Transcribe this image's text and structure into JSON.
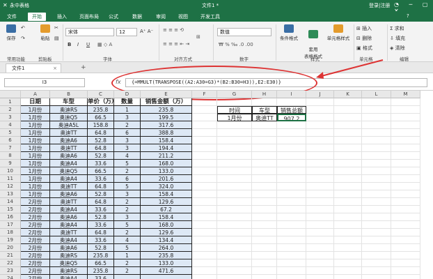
{
  "titlebar": {
    "logo": "✕",
    "app": "永中表格",
    "document": "文件1 *",
    "login": "登录|注册",
    "window_buttons": "◔ ─ ▢ ✕"
  },
  "menu": {
    "items": [
      "文件",
      "开始",
      "插入",
      "页面布局",
      "公式",
      "数据",
      "审阅",
      "视图",
      "开发工具"
    ],
    "active": "开始",
    "help": "?"
  },
  "ribbon": {
    "save": "保存",
    "paste": "粘贴",
    "common": "常用功能",
    "clipboard": "剪贴板",
    "font_name": "宋体",
    "font_size": "12",
    "font_group": "字体",
    "align_group": "对齐方式",
    "number_format": "数值",
    "number_group": "数字",
    "cond_format": "条件格式",
    "table_format": "套用\n表格格式",
    "cell_style": "单元格样式",
    "style_group": "样式",
    "insert": "插入",
    "delete": "删除",
    "format": "格式",
    "cells_group": "单元格",
    "sum": "求和",
    "fill": "填充",
    "clear": "清除",
    "edit_group": "编辑",
    "bold": "B",
    "italic": "I",
    "underline": "U"
  },
  "tabs": {
    "file_tab": "文件1",
    "close": "×",
    "new_tab": "+"
  },
  "formula_bar": {
    "name_box": "I3",
    "fx": "fx",
    "formula": "{=MMULT(TRANSPOSE((A2:A30=G3)*(B2:B30=H3)),E2:E30)}"
  },
  "columns": [
    "A",
    "B",
    "C",
    "D",
    "E",
    "F",
    "G",
    "H",
    "I",
    "J",
    "K",
    "L",
    "M"
  ],
  "table": {
    "headers": [
      "日期",
      "车型",
      "单价（万）",
      "数量",
      "销售金额（万）"
    ],
    "rows": [
      [
        "1月份",
        "奥迪RS",
        "235.8",
        "1",
        "235.8"
      ],
      [
        "1月份",
        "奥迪Q5",
        "66.5",
        "3",
        "199.5"
      ],
      [
        "1月份",
        "奥迪A5L",
        "158.8",
        "2",
        "317.6"
      ],
      [
        "1月份",
        "奥迪TT",
        "64.8",
        "6",
        "388.8"
      ],
      [
        "1月份",
        "奥迪A6",
        "52.8",
        "3",
        "158.4"
      ],
      [
        "1月份",
        "奥迪TT",
        "64.8",
        "3",
        "194.4"
      ],
      [
        "1月份",
        "奥迪A6",
        "52.8",
        "4",
        "211.2"
      ],
      [
        "1月份",
        "奥迪A4",
        "33.6",
        "5",
        "168.0"
      ],
      [
        "1月份",
        "奥迪Q5",
        "66.5",
        "2",
        "133.0"
      ],
      [
        "1月份",
        "奥迪A4",
        "33.6",
        "6",
        "201.6"
      ],
      [
        "1月份",
        "奥迪TT",
        "64.8",
        "5",
        "324.0"
      ],
      [
        "1月份",
        "奥迪A6",
        "52.8",
        "3",
        "158.4"
      ],
      [
        "2月份",
        "奥迪TT",
        "64.8",
        "2",
        "129.6"
      ],
      [
        "2月份",
        "奥迪A4",
        "33.6",
        "2",
        "67.2"
      ],
      [
        "2月份",
        "奥迪A6",
        "52.8",
        "3",
        "158.4"
      ],
      [
        "2月份",
        "奥迪A4",
        "33.6",
        "5",
        "168.0"
      ],
      [
        "2月份",
        "奥迪TT",
        "64.8",
        "2",
        "129.6"
      ],
      [
        "2月份",
        "奥迪A4",
        "33.6",
        "4",
        "134.4"
      ],
      [
        "2月份",
        "奥迪A6",
        "52.8",
        "5",
        "264.0"
      ],
      [
        "2月份",
        "奥迪RS",
        "235.8",
        "1",
        "235.8"
      ],
      [
        "2月份",
        "奥迪Q5",
        "66.5",
        "2",
        "133.0"
      ],
      [
        "2月份",
        "奥迪RS",
        "235.8",
        "2",
        "471.6"
      ],
      [
        "2月份",
        "奥迪A4",
        "33.6",
        "",
        ""
      ]
    ]
  },
  "summary": {
    "headers": [
      "时间",
      "车型",
      "销售总额"
    ],
    "values": [
      "1月份",
      "奥迪TT",
      "907.2"
    ]
  }
}
